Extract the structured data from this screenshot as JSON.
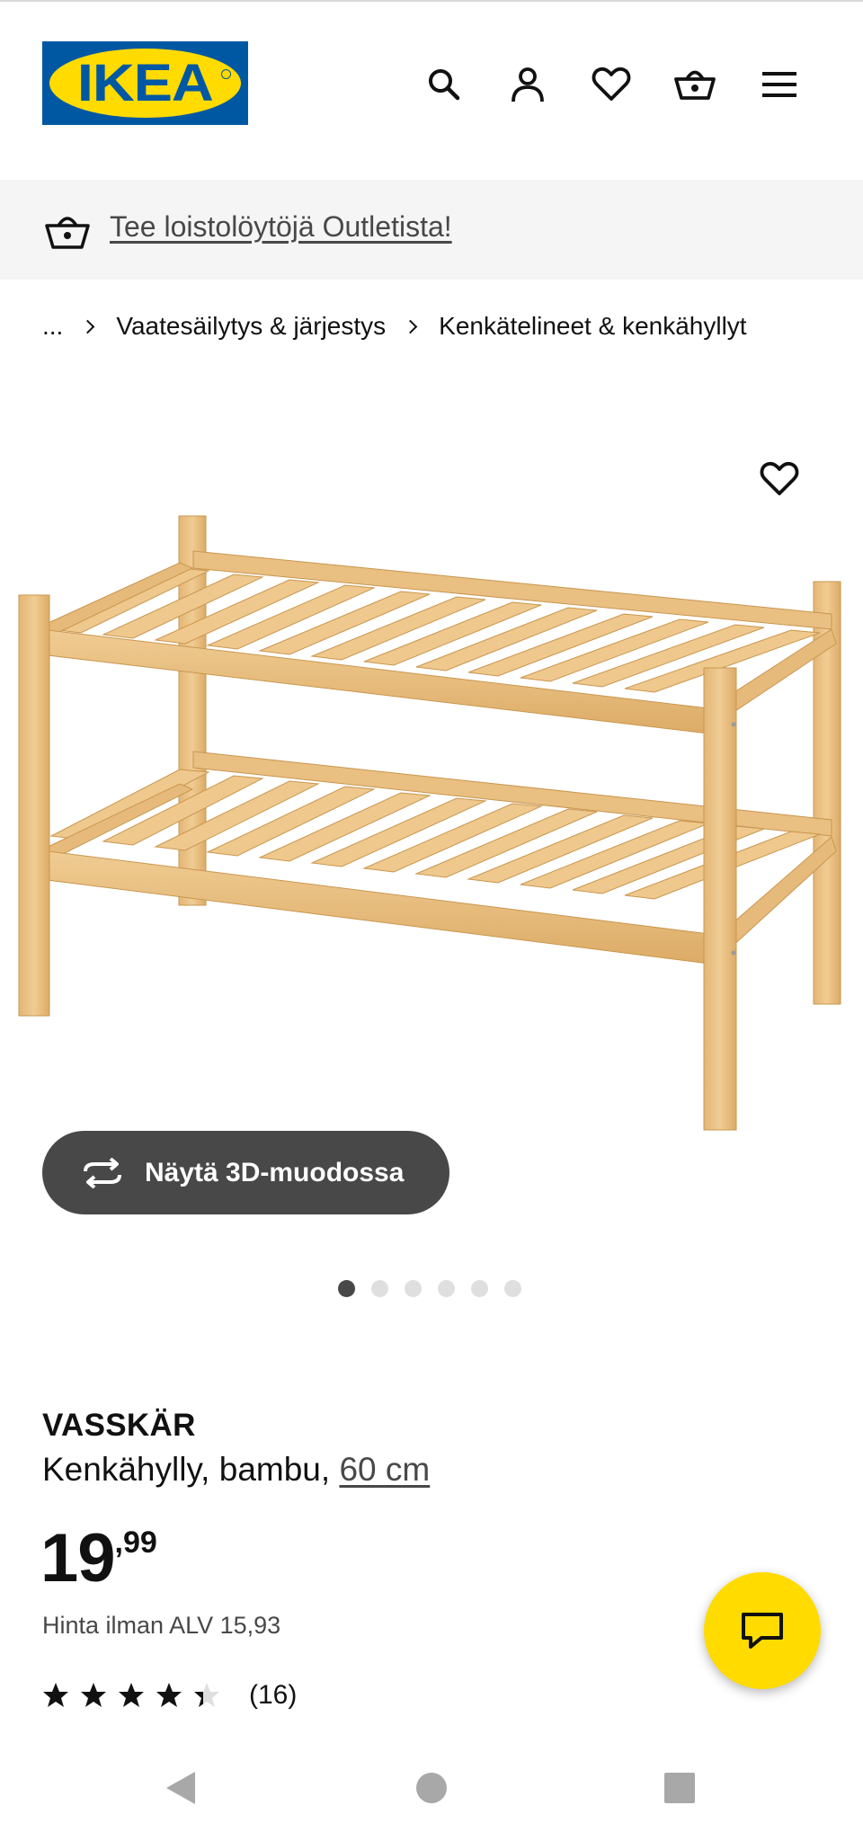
{
  "header": {
    "logo_text": "IKEA",
    "icons": [
      "search-icon",
      "user-icon",
      "heart-icon",
      "basket-icon",
      "menu-icon"
    ]
  },
  "banner": {
    "icon": "basket-icon",
    "link_text": "Tee loistolöytöjä Outletista!"
  },
  "breadcrumb": {
    "items": [
      "...",
      "Vaatesäilytys & järjestys",
      "Kenkätelineet & kenkähyllyt"
    ]
  },
  "gallery": {
    "view_3d_label": "Näytä 3D-muodossa",
    "image_count": 6,
    "active_index": 0
  },
  "product": {
    "name": "VASSKÄR",
    "description": "Kenkähylly, bambu,",
    "size": "60 cm",
    "price_integer": "19",
    "price_decimal": ",99",
    "vat_text": "Hinta ilman ALV 15,93",
    "rating_value": 4.3,
    "rating_max": 5,
    "review_count": "(16)"
  },
  "colors": {
    "brand_blue": "#0058a3",
    "brand_yellow": "#ffdb00",
    "dark_button": "#484848",
    "banner_bg": "#f5f5f5",
    "bamboo": "#e7bd7f"
  },
  "system_nav": [
    "back-icon",
    "home-icon",
    "recents-icon"
  ]
}
